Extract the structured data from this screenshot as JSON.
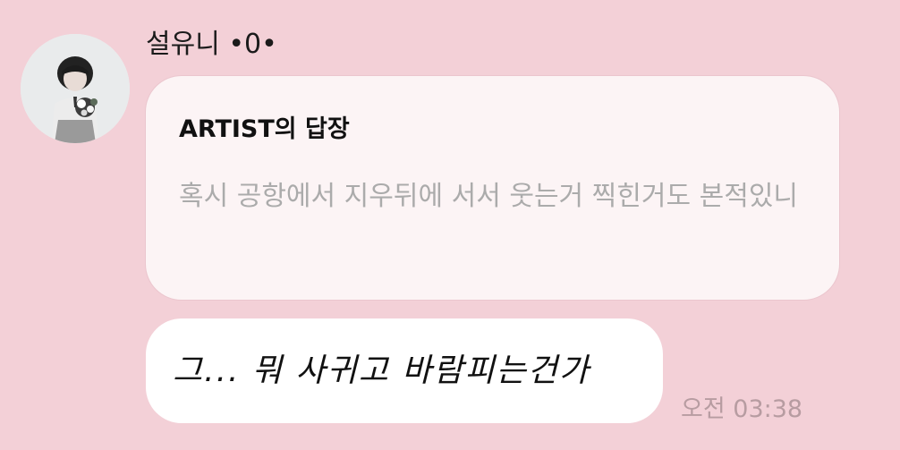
{
  "chat": {
    "sender_name": "설유니 •0•",
    "avatar_icon": "profile-photo-avatar",
    "reply": {
      "title": "ARTIST의 답장",
      "quoted_text": "혹시 공항에서 지우뒤에 서서 웃는거 찍힌거도 본적있니"
    },
    "message": {
      "text": "그... 뭐 사귀고 바람피는건가",
      "time": "오전 03:38"
    }
  },
  "colors": {
    "background": "#f3d0d7",
    "reply_card": "#fcf4f5",
    "bubble": "#ffffff",
    "quote_text": "#ababab",
    "timestamp": "#b79ca1"
  }
}
